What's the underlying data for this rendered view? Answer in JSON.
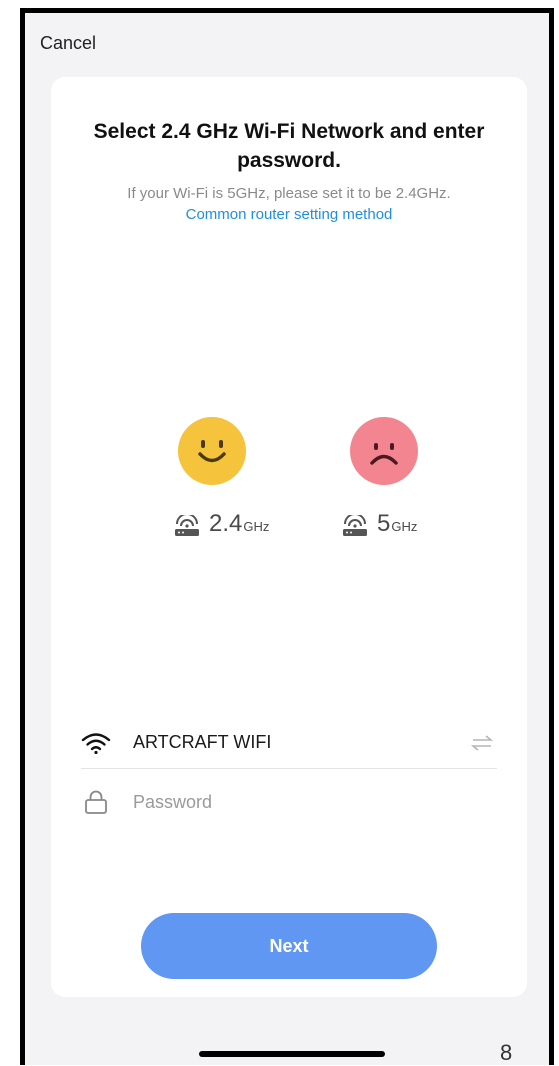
{
  "header": {
    "cancel_label": "Cancel"
  },
  "main": {
    "title": "Select 2.4 GHz Wi-Fi Network and enter password.",
    "hint": "If your Wi-Fi is 5GHz, please set it to be 2.4GHz.",
    "link": "Common router setting method",
    "bands": [
      {
        "num": "2.4",
        "unit": "GHz",
        "face": "happy",
        "color": "#f5c33c"
      },
      {
        "num": "5",
        "unit": "GHz",
        "face": "sad",
        "color": "#f28590"
      }
    ]
  },
  "form": {
    "ssid": "ARTCRAFT WIFI",
    "password_placeholder": "Password",
    "password_value": ""
  },
  "footer": {
    "next_label": "Next",
    "accent_color": "#5f97f2",
    "page_number": "8"
  }
}
